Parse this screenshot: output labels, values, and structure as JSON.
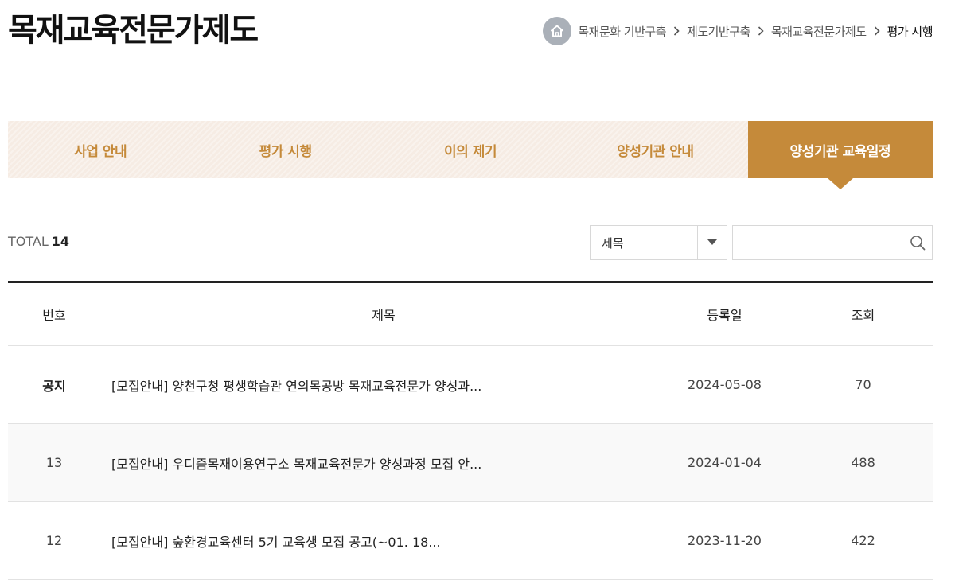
{
  "page": {
    "title": "목재교육전문가제도"
  },
  "breadcrumb": {
    "items": [
      "목재문화 기반구축",
      "제도기반구축",
      "목재교육전문가제도"
    ],
    "current": "평가 시행"
  },
  "tabs": [
    {
      "label": "사업 안내",
      "active": false
    },
    {
      "label": "평가 시행",
      "active": false
    },
    {
      "label": "이의 제기",
      "active": false
    },
    {
      "label": "양성기관 안내",
      "active": false
    },
    {
      "label": "양성기관 교육일정",
      "active": true
    }
  ],
  "list": {
    "total_label": "TOTAL",
    "total_count": "14"
  },
  "search": {
    "field_selected": "제목",
    "query": "",
    "placeholder": ""
  },
  "table": {
    "headers": {
      "no": "번호",
      "title": "제목",
      "date": "등록일",
      "views": "조회"
    },
    "rows": [
      {
        "no": "공지",
        "title": "[모집안내] 양천구청 평생학습관 연의목공방 목재교육전문가 양성과...",
        "date": "2024-05-08",
        "views": "70"
      },
      {
        "no": "13",
        "title": "[모집안내] 우디즘목재이용연구소 목재교육전문가 양성과정 모집 안...",
        "date": "2024-01-04",
        "views": "488"
      },
      {
        "no": "12",
        "title": "[모집안내] 숲환경교육센터 5기 교육생 모집 공고(~01. 18...",
        "date": "2023-11-20",
        "views": "422"
      }
    ]
  },
  "colors": {
    "accent": "#c58a3a",
    "tab_bg": "#f6ece4",
    "home_icon_bg": "#aab0b8"
  }
}
